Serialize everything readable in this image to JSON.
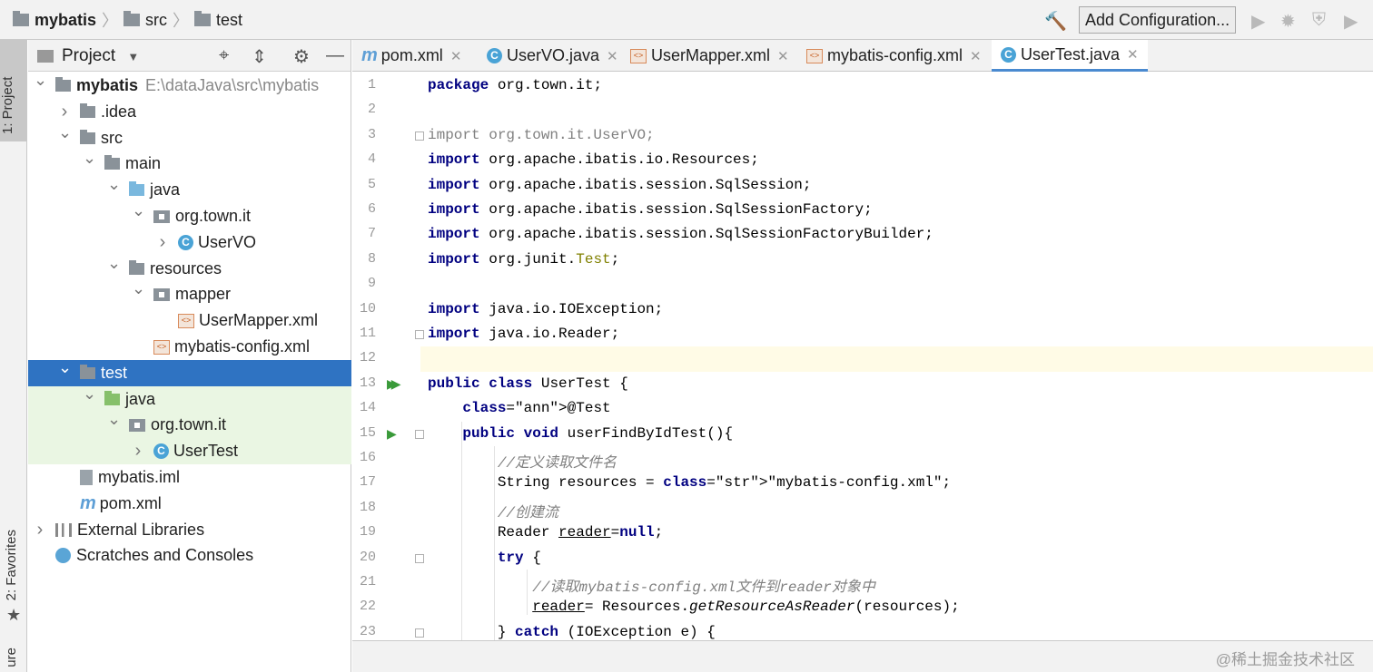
{
  "breadcrumb": [
    "mybatis",
    "src",
    "test"
  ],
  "toolbar": {
    "add_configuration": "Add Configuration..."
  },
  "side_tabs": {
    "project": "1: Project",
    "favorites": "2: Favorites",
    "structure": "ure"
  },
  "project_panel": {
    "title": "Project",
    "tree": [
      {
        "label": "mybatis",
        "path": "E:\\dataJava\\src\\mybatis",
        "icon": "module-folder-icon",
        "expanded": true
      },
      {
        "label": ".idea",
        "icon": "folder-icon",
        "expanded": false
      },
      {
        "label": "src",
        "icon": "folder-icon",
        "expanded": true
      },
      {
        "label": "main",
        "icon": "folder-icon",
        "expanded": true
      },
      {
        "label": "java",
        "icon": "source-folder-icon",
        "expanded": true
      },
      {
        "label": "org.town.it",
        "icon": "package-icon",
        "expanded": true
      },
      {
        "label": "UserVO",
        "icon": "class-icon",
        "expanded": false
      },
      {
        "label": "resources",
        "icon": "resources-folder-icon",
        "expanded": true
      },
      {
        "label": "mapper",
        "icon": "package-icon",
        "expanded": true
      },
      {
        "label": "UserMapper.xml",
        "icon": "xml-file-icon"
      },
      {
        "label": "mybatis-config.xml",
        "icon": "xml-file-icon"
      },
      {
        "label": "test",
        "icon": "folder-icon",
        "expanded": true,
        "selected": true
      },
      {
        "label": "java",
        "icon": "test-source-folder-icon",
        "expanded": true
      },
      {
        "label": "org.town.it",
        "icon": "package-icon",
        "expanded": true
      },
      {
        "label": "UserTest",
        "icon": "test-class-icon",
        "expanded": false
      },
      {
        "label": "mybatis.iml",
        "icon": "iml-file-icon"
      },
      {
        "label": "pom.xml",
        "icon": "maven-icon"
      },
      {
        "label": "External Libraries",
        "icon": "library-icon",
        "expanded": false
      },
      {
        "label": "Scratches and Consoles",
        "icon": "scratches-icon"
      }
    ]
  },
  "tabs": [
    {
      "label": "pom.xml",
      "icon": "maven-icon"
    },
    {
      "label": "UserVO.java",
      "icon": "class-icon"
    },
    {
      "label": "UserMapper.xml",
      "icon": "xml-file-icon"
    },
    {
      "label": "mybatis-config.xml",
      "icon": "xml-file-icon"
    },
    {
      "label": "UserTest.java",
      "icon": "class-icon",
      "active": true
    }
  ],
  "editor": {
    "line_numbers": [
      "1",
      "2",
      "3",
      "4",
      "5",
      "6",
      "7",
      "8",
      "9",
      "10",
      "11",
      "12",
      "13",
      "14",
      "15",
      "16",
      "17",
      "18",
      "19",
      "20",
      "21",
      "22",
      "23"
    ],
    "current_line": 12,
    "code": [
      "package org.town.it;",
      "",
      "import org.town.it.UserVO;",
      "import org.apache.ibatis.io.Resources;",
      "import org.apache.ibatis.session.SqlSession;",
      "import org.apache.ibatis.session.SqlSessionFactory;",
      "import org.apache.ibatis.session.SqlSessionFactoryBuilder;",
      "import org.junit.Test;",
      "",
      "import java.io.IOException;",
      "import java.io.Reader;",
      "",
      "public class UserTest {",
      "    @Test",
      "    public void userFindByIdTest(){",
      "        //定义读取文件名",
      "        String resources = \"mybatis-config.xml\";",
      "        //创建流",
      "        Reader reader=null;",
      "        try {",
      "            //读取mybatis-config.xml文件到reader对象中",
      "            reader= Resources.getResourceAsReader(resources);",
      "        } catch (IOException e) {"
    ]
  },
  "watermark": "@稀土掘金技术社区",
  "colors": {
    "selection": "#2f73c2",
    "test_highlight": "#eaf6e3",
    "keyword": "#000080",
    "string": "#008000",
    "comment": "#808080",
    "annotation": "#808000"
  }
}
